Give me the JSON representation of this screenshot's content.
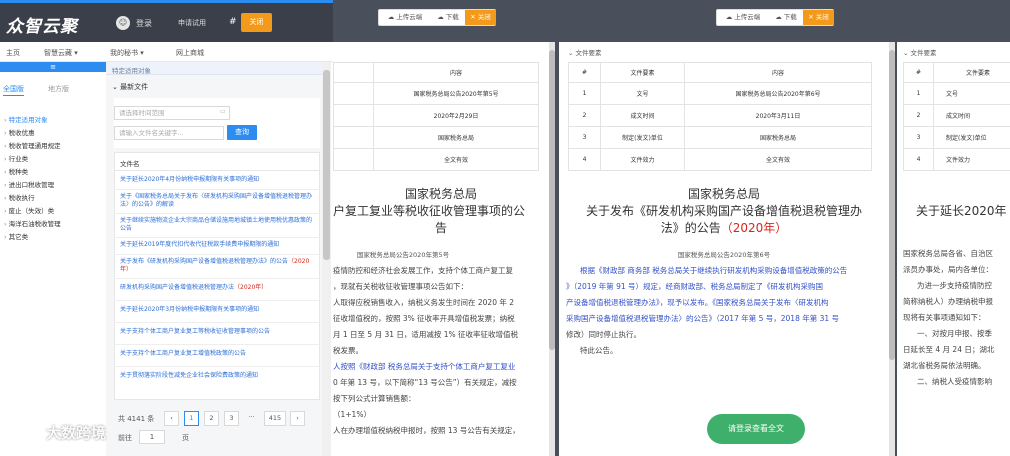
{
  "app": {
    "logo": "众智云聚",
    "login": "登录",
    "trial": "申请试用",
    "hash": "#",
    "close": "关闭",
    "login_icon": "user-icon"
  },
  "nav": [
    "主页",
    "智慧云藏 ▾",
    "我的秘书 ▾",
    "网上商城"
  ],
  "sidebar": {
    "header": "≡",
    "tabs": [
      "全国版",
      "地方版"
    ],
    "items": [
      "特定适用对象",
      "税收优惠",
      "税收管理通用规定",
      "行业类",
      "税种类",
      "进出口税收管理",
      "税收执行",
      "废止（失效）类",
      "海洋石油税收管理",
      "其它类"
    ]
  },
  "content": {
    "breadcrumb": "特定适用对象",
    "panel_title": "最新文件",
    "date_placeholder": "请选择时间范围",
    "name_placeholder": "请输入文件名关键字...",
    "search_label": "查询",
    "list_header": "文件名",
    "files": [
      {
        "text": "关于延长2020年4月份纳税申报期限有关事项的通知",
        "red": ""
      },
      {
        "text": "关于《国家税务总局关于发布〈研发机构采购国产设备增值税退税管理办法〉的公告》的解读",
        "red": ""
      },
      {
        "text": "关于继续实施物流企业大宗商品仓储设施用地城镇土地使用税优惠政策的公告",
        "red": ""
      },
      {
        "text": "关于延长2019年度代扣代收代征税款手续费申报期限的通知",
        "red": ""
      },
      {
        "text": "关于发布《研发机构采购国产设备增值税退税管理办法》的公告",
        "red": "（2020年）"
      },
      {
        "text": "研发机构采购国产设备增值税退税管理办法",
        "red": "（2020年）"
      },
      {
        "text": "关于延长2020年3月份纳税申报期限有关事项的通知",
        "red": ""
      },
      {
        "text": "关于支持个体工商户复业复工等税收征收管理事项的公告",
        "red": ""
      },
      {
        "text": "关于支持个体工商户复业复工增值税政策的公告",
        "red": ""
      },
      {
        "text": "关于贯彻落实阶段性减免企业社会保险费政策的通知",
        "red": ""
      }
    ],
    "total": "共 4141 条",
    "pages": [
      "‹",
      "1",
      "2",
      "3",
      "···",
      "415",
      "›"
    ],
    "goto_label": "前往",
    "goto_value": "1",
    "goto_unit": "页"
  },
  "watermark": "大数跨境",
  "toolbar": {
    "upload": "上传云端",
    "download": "下载",
    "close": "关闭"
  },
  "pane1": {
    "table_header": "内容",
    "rows": [
      "国家税务总局公告2020年第5号",
      "2020年2月29日",
      "国家税务总局",
      "全文有效"
    ],
    "title_lines": [
      "国家税务总局",
      "户复工复业等税收征收管理事项的公",
      "告"
    ],
    "subtitle": "国家税务总局公告2020年第5号",
    "paras": [
      "疫情防控和经济社会发展工作，支持个体工商户复工复",
      "，现就有关税收征收管理事项公告如下：",
      "人取得应税销售收入，纳税义务发生时间在 2020 年 2",
      "征收增值税的，按照 3% 征收率开具增值税发票；纳税",
      "月 1 日至 5 月 31 日，适用减按 1% 征收率征收增值税",
      "税发票。",
      "人按照《财政部 税务总局关于支持个体工商户复工复业",
      "0 年第 13 号，以下简称“13 号公告”）有关规定，减按",
      "按下列公式计算销售额：",
      "（1+1%）",
      "人在办理增值税纳税申报时，按照 13 号公告有关规定，"
    ]
  },
  "pane2": {
    "section": "文件要素",
    "cols": [
      "#",
      "文件要素",
      "内容"
    ],
    "rows": [
      [
        "1",
        "文号",
        "国家税务总局公告2020年第6号"
      ],
      [
        "2",
        "成文时间",
        "2020年3月11日"
      ],
      [
        "3",
        "制定(发文)单位",
        "国家税务总局"
      ],
      [
        "4",
        "文件效力",
        "全文有效"
      ]
    ],
    "title_lines": [
      "国家税务总局",
      "关于发布《研发机构采购国产设备增值税退税管理办",
      "法》的公告"
    ],
    "title_red": "（2020年）",
    "subtitle": "国家税务总局公告2020年第6号",
    "paras": [
      "根据《财政部 商务部 税务总局关于继续执行研发机构采购设备增值税政策的公告",
      "》（2019 年第 91 号）规定，经商财政部、税务总局制定了《研发机构采购国",
      "产设备增值税退税管理办法》，现予以发布。《国家税务总局关于发布〈研发机构",
      "采购国产设备增值税退税管理办法〉的公告》（2017 年第 5 号，2018 年第 31 号",
      "修改）同时停止执行。",
      "特此公告。"
    ],
    "cta": "请登录查看全文"
  },
  "pane3": {
    "section": "文件要素",
    "cols": [
      "#",
      "文件要素"
    ],
    "rows": [
      [
        "1",
        "文号"
      ],
      [
        "2",
        "成文时间"
      ],
      [
        "3",
        "制定(发文)单位"
      ],
      [
        "4",
        "文件效力"
      ]
    ],
    "title": "关于延长2020年",
    "paras": [
      "国家税务总局各省、自治区",
      "派员办事处，局内各单位：",
      "为进一步支持疫情防控",
      "简称纳税人）办理纳税申报",
      "现将有关事项通知如下：",
      "一、对按月申报、按季",
      "日延长至 4 月 24 日；湖北",
      "湖北省税务局依法明确。",
      "二、纳税人受疫情影响"
    ]
  }
}
